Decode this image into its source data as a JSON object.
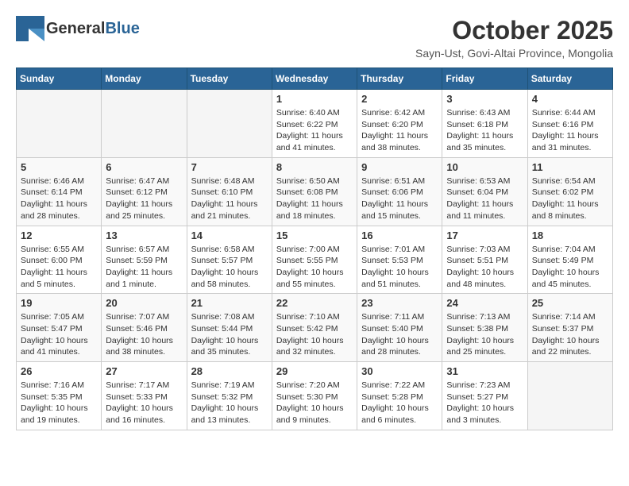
{
  "header": {
    "logo_general": "General",
    "logo_blue": "Blue",
    "month_title": "October 2025",
    "subtitle": "Sayn-Ust, Govi-Altai Province, Mongolia"
  },
  "days_of_week": [
    "Sunday",
    "Monday",
    "Tuesday",
    "Wednesday",
    "Thursday",
    "Friday",
    "Saturday"
  ],
  "weeks": [
    [
      {
        "day": "",
        "info": ""
      },
      {
        "day": "",
        "info": ""
      },
      {
        "day": "",
        "info": ""
      },
      {
        "day": "1",
        "info": "Sunrise: 6:40 AM\nSunset: 6:22 PM\nDaylight: 11 hours and 41 minutes."
      },
      {
        "day": "2",
        "info": "Sunrise: 6:42 AM\nSunset: 6:20 PM\nDaylight: 11 hours and 38 minutes."
      },
      {
        "day": "3",
        "info": "Sunrise: 6:43 AM\nSunset: 6:18 PM\nDaylight: 11 hours and 35 minutes."
      },
      {
        "day": "4",
        "info": "Sunrise: 6:44 AM\nSunset: 6:16 PM\nDaylight: 11 hours and 31 minutes."
      }
    ],
    [
      {
        "day": "5",
        "info": "Sunrise: 6:46 AM\nSunset: 6:14 PM\nDaylight: 11 hours and 28 minutes."
      },
      {
        "day": "6",
        "info": "Sunrise: 6:47 AM\nSunset: 6:12 PM\nDaylight: 11 hours and 25 minutes."
      },
      {
        "day": "7",
        "info": "Sunrise: 6:48 AM\nSunset: 6:10 PM\nDaylight: 11 hours and 21 minutes."
      },
      {
        "day": "8",
        "info": "Sunrise: 6:50 AM\nSunset: 6:08 PM\nDaylight: 11 hours and 18 minutes."
      },
      {
        "day": "9",
        "info": "Sunrise: 6:51 AM\nSunset: 6:06 PM\nDaylight: 11 hours and 15 minutes."
      },
      {
        "day": "10",
        "info": "Sunrise: 6:53 AM\nSunset: 6:04 PM\nDaylight: 11 hours and 11 minutes."
      },
      {
        "day": "11",
        "info": "Sunrise: 6:54 AM\nSunset: 6:02 PM\nDaylight: 11 hours and 8 minutes."
      }
    ],
    [
      {
        "day": "12",
        "info": "Sunrise: 6:55 AM\nSunset: 6:00 PM\nDaylight: 11 hours and 5 minutes."
      },
      {
        "day": "13",
        "info": "Sunrise: 6:57 AM\nSunset: 5:59 PM\nDaylight: 11 hours and 1 minute."
      },
      {
        "day": "14",
        "info": "Sunrise: 6:58 AM\nSunset: 5:57 PM\nDaylight: 10 hours and 58 minutes."
      },
      {
        "day": "15",
        "info": "Sunrise: 7:00 AM\nSunset: 5:55 PM\nDaylight: 10 hours and 55 minutes."
      },
      {
        "day": "16",
        "info": "Sunrise: 7:01 AM\nSunset: 5:53 PM\nDaylight: 10 hours and 51 minutes."
      },
      {
        "day": "17",
        "info": "Sunrise: 7:03 AM\nSunset: 5:51 PM\nDaylight: 10 hours and 48 minutes."
      },
      {
        "day": "18",
        "info": "Sunrise: 7:04 AM\nSunset: 5:49 PM\nDaylight: 10 hours and 45 minutes."
      }
    ],
    [
      {
        "day": "19",
        "info": "Sunrise: 7:05 AM\nSunset: 5:47 PM\nDaylight: 10 hours and 41 minutes."
      },
      {
        "day": "20",
        "info": "Sunrise: 7:07 AM\nSunset: 5:46 PM\nDaylight: 10 hours and 38 minutes."
      },
      {
        "day": "21",
        "info": "Sunrise: 7:08 AM\nSunset: 5:44 PM\nDaylight: 10 hours and 35 minutes."
      },
      {
        "day": "22",
        "info": "Sunrise: 7:10 AM\nSunset: 5:42 PM\nDaylight: 10 hours and 32 minutes."
      },
      {
        "day": "23",
        "info": "Sunrise: 7:11 AM\nSunset: 5:40 PM\nDaylight: 10 hours and 28 minutes."
      },
      {
        "day": "24",
        "info": "Sunrise: 7:13 AM\nSunset: 5:38 PM\nDaylight: 10 hours and 25 minutes."
      },
      {
        "day": "25",
        "info": "Sunrise: 7:14 AM\nSunset: 5:37 PM\nDaylight: 10 hours and 22 minutes."
      }
    ],
    [
      {
        "day": "26",
        "info": "Sunrise: 7:16 AM\nSunset: 5:35 PM\nDaylight: 10 hours and 19 minutes."
      },
      {
        "day": "27",
        "info": "Sunrise: 7:17 AM\nSunset: 5:33 PM\nDaylight: 10 hours and 16 minutes."
      },
      {
        "day": "28",
        "info": "Sunrise: 7:19 AM\nSunset: 5:32 PM\nDaylight: 10 hours and 13 minutes."
      },
      {
        "day": "29",
        "info": "Sunrise: 7:20 AM\nSunset: 5:30 PM\nDaylight: 10 hours and 9 minutes."
      },
      {
        "day": "30",
        "info": "Sunrise: 7:22 AM\nSunset: 5:28 PM\nDaylight: 10 hours and 6 minutes."
      },
      {
        "day": "31",
        "info": "Sunrise: 7:23 AM\nSunset: 5:27 PM\nDaylight: 10 hours and 3 minutes."
      },
      {
        "day": "",
        "info": ""
      }
    ]
  ]
}
